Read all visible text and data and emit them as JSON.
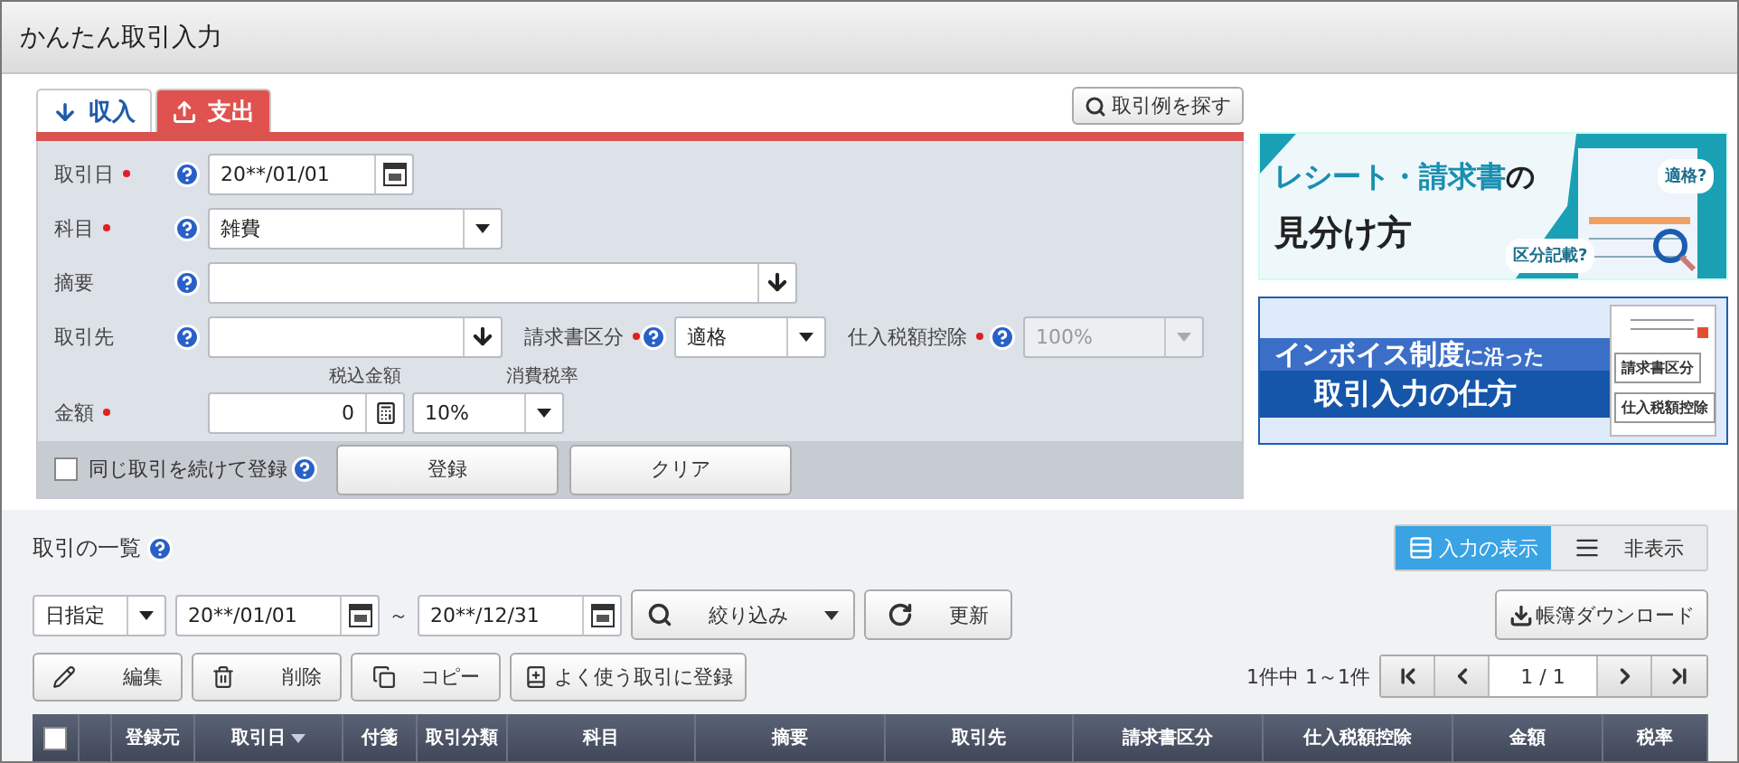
{
  "window": {
    "title": "かんたん取引入力"
  },
  "tabs": [
    {
      "label": "収入",
      "kind": "income",
      "selected": false
    },
    {
      "label": "支出",
      "kind": "expense",
      "selected": true
    }
  ],
  "search_examples_button": "取引例を探す",
  "form": {
    "date": {
      "label": "取引日",
      "required": true,
      "value": "20**/01/01"
    },
    "account": {
      "label": "科目",
      "required": true,
      "value": "雑費"
    },
    "memo": {
      "label": "摘要",
      "required": false
    },
    "partner": {
      "label": "取引先",
      "required": false
    },
    "invoice_type": {
      "label": "請求書区分",
      "required": true,
      "value": "適格"
    },
    "deduction": {
      "label": "仕入税額控除",
      "required": true,
      "value": "100%",
      "disabled": true
    },
    "amount": {
      "label": "金額",
      "required": true,
      "tax_included_label": "税込金額",
      "value": "0",
      "tax_rate_label": "消費税率",
      "tax_rate": "10%"
    }
  },
  "continue_checkbox": {
    "label": "同じ取引を続けて登録",
    "checked": false
  },
  "form_buttons": [
    "登録",
    "クリア"
  ],
  "banners": [
    {
      "kind": "receipt",
      "highlight": "レシート・請求書",
      "rest": "の",
      "line2": "見分け方",
      "tags": [
        "適格?",
        "区分記載?"
      ]
    },
    {
      "kind": "invoice",
      "highlight": "インボイス制度",
      "rest": "に沿った",
      "line2": "取引入力の仕方",
      "tags": [
        "請求書区分",
        "仕入税額控除"
      ]
    }
  ],
  "list": {
    "title": "取引の一覧",
    "view_toggle": [
      {
        "label": "入力の表示",
        "selected": true
      },
      {
        "label": "非表示",
        "selected": false
      }
    ],
    "period_mode": "日指定",
    "from": "20**/01/01",
    "separator": "～",
    "to": "20**/12/31",
    "filter_button": "絞り込み",
    "refresh_button": "更新",
    "download_button": "帳簿ダウンロード",
    "actions": [
      {
        "label": "編集",
        "kind": "edit"
      },
      {
        "label": "削除",
        "kind": "delete"
      },
      {
        "label": "コピー",
        "kind": "copy"
      },
      {
        "label": "よく使う取引に登録",
        "kind": "favorite"
      }
    ],
    "count": "1件中 1～1件",
    "page": "1 / 1",
    "columns": [
      {
        "kind": "checkbox",
        "checked": false
      },
      {
        "kind": "blank"
      },
      {
        "label": "登録元",
        "sorted": false
      },
      {
        "label": "取引日",
        "sorted": true
      },
      {
        "label": "付箋",
        "sorted": false
      },
      {
        "label": "取引分類",
        "sorted": false
      },
      {
        "label": "科目",
        "sorted": false
      },
      {
        "label": "摘要",
        "sorted": false
      },
      {
        "label": "取引先",
        "sorted": false
      },
      {
        "label": "請求書区分",
        "sorted": false
      },
      {
        "label": "仕入税額控除",
        "sorted": false
      },
      {
        "label": "金額",
        "sorted": false
      },
      {
        "label": "税率",
        "sorted": false
      }
    ]
  }
}
